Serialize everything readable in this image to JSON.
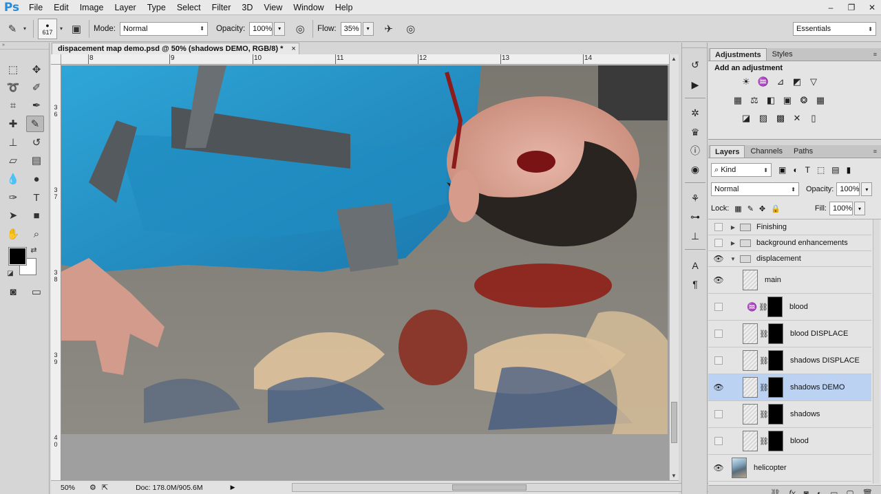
{
  "app": {
    "logo": "Ps"
  },
  "menu": [
    "File",
    "Edit",
    "Image",
    "Layer",
    "Type",
    "Select",
    "Filter",
    "3D",
    "View",
    "Window",
    "Help"
  ],
  "window_controls": [
    "–",
    "❐",
    "✕"
  ],
  "options": {
    "brush_size": "617",
    "mode_label": "Mode:",
    "mode_value": "Normal",
    "opacity_label": "Opacity:",
    "opacity_value": "100%",
    "flow_label": "Flow:",
    "flow_value": "35%",
    "workspace": "Essentials"
  },
  "document": {
    "tab_title": "dispacement map demo.psd @ 50% (shadows DEMO, RGB/8) *",
    "close": "×",
    "zoom": "50%",
    "doc_info": "Doc: 178.0M/905.6M",
    "ruler_h": [
      "8",
      "9",
      "10",
      "11",
      "12",
      "13",
      "14"
    ],
    "ruler_v": [
      [
        "3",
        "6"
      ],
      [
        "3",
        "7"
      ],
      [
        "3",
        "8"
      ],
      [
        "3",
        "9"
      ],
      [
        "4",
        "0"
      ]
    ]
  },
  "adjustments": {
    "tabs": [
      "Adjustments",
      "Styles"
    ],
    "title": "Add an adjustment"
  },
  "layers_panel": {
    "tabs": [
      "Layers",
      "Channels",
      "Paths"
    ],
    "filter_kind": "Kind",
    "blend_mode": "Normal",
    "opacity_label": "Opacity:",
    "opacity_value": "100%",
    "lock_label": "Lock:",
    "fill_label": "Fill:",
    "fill_value": "100%",
    "layers": [
      {
        "name": "Finishing",
        "type": "group",
        "visible": false,
        "expanded": false
      },
      {
        "name": "background enhancements",
        "type": "group",
        "visible": false,
        "expanded": false
      },
      {
        "name": "displacement",
        "type": "group",
        "visible": true,
        "expanded": true
      },
      {
        "name": "main",
        "type": "layer",
        "visible": true
      },
      {
        "name": "blood",
        "type": "adjustment",
        "visible": false
      },
      {
        "name": "blood DISPLACE",
        "type": "masked",
        "visible": false
      },
      {
        "name": "shadows DISPLACE",
        "type": "masked",
        "visible": false
      },
      {
        "name": "shadows DEMO",
        "type": "masked",
        "visible": true,
        "selected": true
      },
      {
        "name": "shadows",
        "type": "masked",
        "visible": false
      },
      {
        "name": "blood",
        "type": "masked",
        "visible": false
      },
      {
        "name": "helicopter",
        "type": "photo",
        "visible": true
      }
    ]
  }
}
